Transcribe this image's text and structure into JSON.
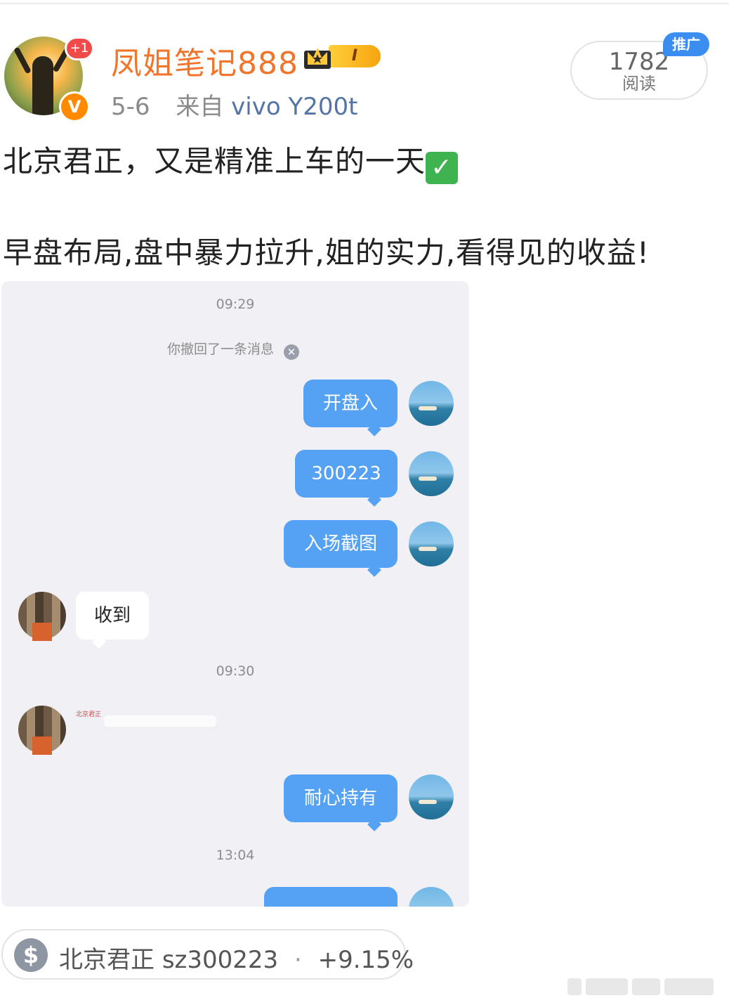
{
  "post": {
    "username": "凤姐笔记888",
    "notification_count": "+1",
    "verified_badge": "V",
    "level_badge": "I",
    "date": "5-6",
    "source_prefix": "来自",
    "device": "vivo Y200t",
    "read_count": "1782",
    "read_label": "阅读",
    "promo_label": "推广",
    "line1": "北京君正，又是精准上车的一天",
    "check_icon": "✓",
    "line2": "早盘布局,盘中暴力拉升,姐的实力,看得见的收益!"
  },
  "chat": {
    "timestamps": [
      "09:29",
      "09:30",
      "13:04"
    ],
    "recall_notice": "你撤回了一条消息",
    "messages_out": [
      "开盘入",
      "300223",
      "入场截图",
      "耐心持有"
    ],
    "message_in": "收到",
    "share_card_title": "北京君正"
  },
  "stock": {
    "icon": "$",
    "name": "北京君正",
    "code": "sz300223",
    "separator": "·",
    "change": "+9.15%"
  },
  "colors": {
    "username": "#f2752c",
    "device_link": "#5474a6",
    "chat_bubble_out": "#55a2f5",
    "promo_tag": "#3b8df0",
    "verified": "#ff8a00"
  }
}
